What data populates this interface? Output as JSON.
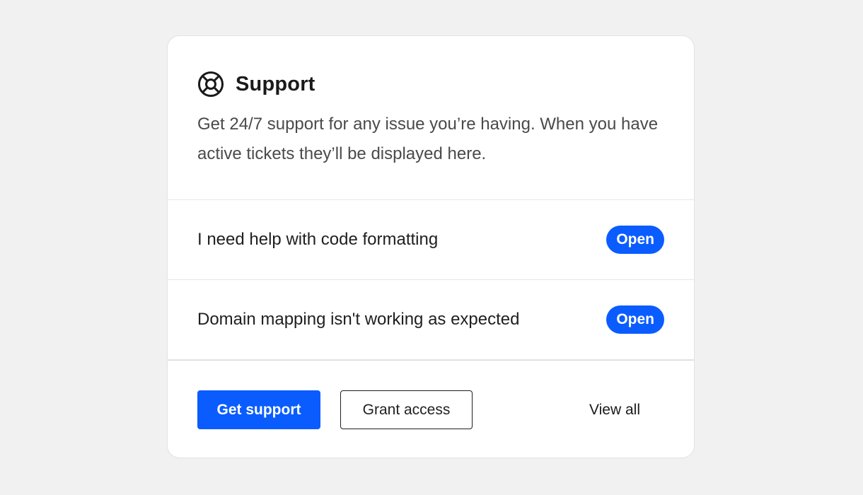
{
  "card": {
    "title": "Support",
    "title_icon": "lifebuoy-icon",
    "description": "Get 24/7 support for any issue you’re having. When you have active tickets they’ll be displayed here."
  },
  "tickets": [
    {
      "label": "I need help with code formatting",
      "status": "Open"
    },
    {
      "label": "Domain mapping isn't working as expected",
      "status": "Open"
    }
  ],
  "actions": {
    "get_support": "Get support",
    "grant_access": "Grant access",
    "view_all": "View all"
  },
  "colors": {
    "accent": "#0a5cff",
    "background": "#f1f1f1",
    "card": "#ffffff",
    "text": "#1a1a1a"
  }
}
